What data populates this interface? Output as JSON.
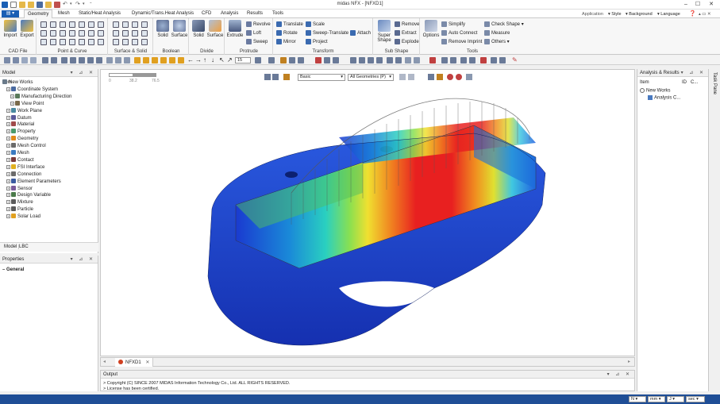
{
  "window": {
    "title": "midas NFX - [NFXD1]",
    "minimize": "–",
    "maximize": "☐",
    "close": "✕"
  },
  "ribbon_tabs": [
    "Geometry",
    "Mesh",
    "Static/Heat Analysis",
    "Dynamic/Trans.Heat Analysis",
    "CFD",
    "Analysis",
    "Results",
    "Tools"
  ],
  "ribbon_right": [
    "Application",
    "Style",
    "Background",
    "Language"
  ],
  "ribbon": {
    "cad_file": {
      "label": "CAD File",
      "import": "Import",
      "export": "Export"
    },
    "point_curve": {
      "label": "Point & Curve"
    },
    "surface_solid": {
      "label": "Surface & Solid"
    },
    "boolean": {
      "label": "Boolean",
      "solid": "Solid",
      "surface": "Surface"
    },
    "divide": {
      "label": "Divide",
      "solid": "Solid",
      "surface": "Surface"
    },
    "protrude": {
      "label": "Protrude",
      "extrude": "Extrude",
      "revolve": "Revolve",
      "loft": "Loft",
      "sweep": "Sweep"
    },
    "transform": {
      "label": "Transform",
      "translate": "Translate",
      "scale": "Scale",
      "rotate": "Rotate",
      "sweep_translate": "Sweep-Translate",
      "attach": "Attach",
      "mirror": "Mirror",
      "project": "Project"
    },
    "sub_shape": {
      "label": "Sub Shape",
      "super_shape": "Super Shape",
      "remove": "Remove",
      "extract": "Extract",
      "explode": "Explode"
    },
    "tools": {
      "label": "Tools",
      "options": "Options",
      "simplify": "Simplify",
      "auto_connect": "Auto Connect",
      "remove_imprint": "Remove Imprint",
      "check_shape": "Check Shape",
      "measure": "Measure",
      "others": "Others"
    }
  },
  "toolbar": {
    "step_value": "15"
  },
  "model_panel": {
    "title": "Model",
    "column": "Item",
    "tree": [
      {
        "label": "New Works",
        "depth": 0,
        "icon": "works-icon",
        "color": "#6a7a8a"
      },
      {
        "label": "Coordinate System",
        "depth": 1,
        "icon": "coord-icon",
        "color": "#4a6aa0"
      },
      {
        "label": "Manufacturing Direction",
        "depth": 2,
        "icon": "direction-icon",
        "color": "#5a7a5a"
      },
      {
        "label": "View Point",
        "depth": 2,
        "icon": "viewpoint-icon",
        "color": "#7a6a4a"
      },
      {
        "label": "Work Plane",
        "depth": 1,
        "icon": "plane-icon",
        "color": "#4a8aa0"
      },
      {
        "label": "Datum",
        "depth": 1,
        "icon": "datum-icon",
        "color": "#5a5a9a"
      },
      {
        "label": "Material",
        "depth": 1,
        "icon": "material-icon",
        "color": "#a04a4a"
      },
      {
        "label": "Property",
        "depth": 1,
        "icon": "property-icon",
        "color": "#4a9a6a"
      },
      {
        "label": "Geometry",
        "depth": 1,
        "icon": "geometry-icon",
        "color": "#e08a1a"
      },
      {
        "label": "Mesh Control",
        "depth": 1,
        "icon": "meshcontrol-icon",
        "color": "#6a6a6a"
      },
      {
        "label": "Mesh",
        "depth": 1,
        "icon": "mesh-icon",
        "color": "#3a7ac0"
      },
      {
        "label": "Contact",
        "depth": 1,
        "icon": "contact-icon",
        "color": "#7a3a3a"
      },
      {
        "label": "FSI Interface",
        "depth": 1,
        "icon": "fsi-icon",
        "color": "#e0b020"
      },
      {
        "label": "Connection",
        "depth": 1,
        "icon": "connection-icon",
        "color": "#6a6a6a"
      },
      {
        "label": "Element Parameters",
        "depth": 1,
        "icon": "element-icon",
        "color": "#3a5aa0"
      },
      {
        "label": "Sensor",
        "depth": 1,
        "icon": "sensor-icon",
        "color": "#7a5a9a"
      },
      {
        "label": "Design Variable",
        "depth": 1,
        "icon": "variable-icon",
        "color": "#4a7a4a"
      },
      {
        "label": "Mixture",
        "depth": 1,
        "icon": "mixture-icon",
        "color": "#5a5a5a"
      },
      {
        "label": "Particle",
        "depth": 1,
        "icon": "particle-icon",
        "color": "#5a5a5a"
      },
      {
        "label": "Solar Load",
        "depth": 1,
        "icon": "solar-icon",
        "color": "#e0a020"
      }
    ],
    "bottom_tabs": [
      "Model",
      "LBC"
    ]
  },
  "properties_panel": {
    "title": "Properties",
    "section": "General"
  },
  "viewport": {
    "scale_ticks": [
      "0",
      "38.2",
      "76.5"
    ],
    "view_mode": "Basic",
    "geometry_filter": "All Geometries (P)",
    "doc_tab": "NFXD1"
  },
  "analysis_panel": {
    "title": "Analysis & Results",
    "columns": [
      "Item",
      "ID",
      "C..."
    ],
    "tree": [
      {
        "label": "New Works",
        "depth": 0
      },
      {
        "label": "Analysis C...",
        "depth": 1
      }
    ]
  },
  "side_strip": {
    "label": "Task Pane"
  },
  "output_panel": {
    "title": "Output",
    "lines": [
      "> Copyright (C) SINCE 2007 MIDAS Information Technology Co., Ltd. ALL RIGHTS RESERVED.",
      "> License has been certified."
    ]
  },
  "status_units": [
    "N",
    "mm",
    "J",
    "sec"
  ],
  "colors": {
    "accent": "#1f4e96",
    "file_button": "#1a5fb4"
  }
}
